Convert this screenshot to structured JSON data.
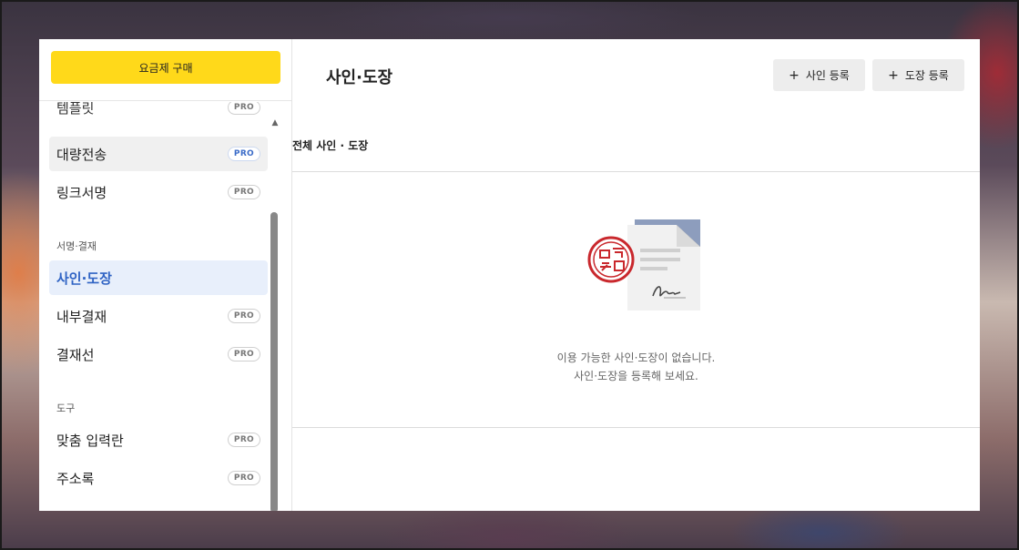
{
  "sidebar": {
    "buy_button": "요금제 구매",
    "items": [
      {
        "label": "템플릿",
        "badge": "PRO"
      },
      {
        "label": "대량전송",
        "badge": "PRO"
      },
      {
        "label": "링크서명",
        "badge": "PRO"
      },
      {
        "label": "사인·도장"
      },
      {
        "label": "내부결재",
        "badge": "PRO"
      },
      {
        "label": "결재선",
        "badge": "PRO"
      },
      {
        "label": "맞춤 입력란",
        "badge": "PRO"
      },
      {
        "label": "주소록",
        "badge": "PRO"
      }
    ],
    "sections": [
      {
        "label": "서명·결재"
      },
      {
        "label": "도구"
      }
    ]
  },
  "main": {
    "title": "사인·도장",
    "buttons": {
      "add_sign": "사인 등록",
      "add_stamp": "도장 등록",
      "plus": "+"
    },
    "subtitle": "전체 사인 · 도장",
    "empty": {
      "line1": "이용 가능한 사인·도장이 없습니다.",
      "line2": "사인·도장을 등록해 보세요."
    }
  },
  "colors": {
    "accent_yellow": "#ffd91a",
    "active_bg": "#e8effb",
    "active_text": "#2f63c4",
    "stamp_red": "#c9282d",
    "doc_blue": "#8d9dbd"
  },
  "icons": {
    "scroll_up": "▲"
  }
}
